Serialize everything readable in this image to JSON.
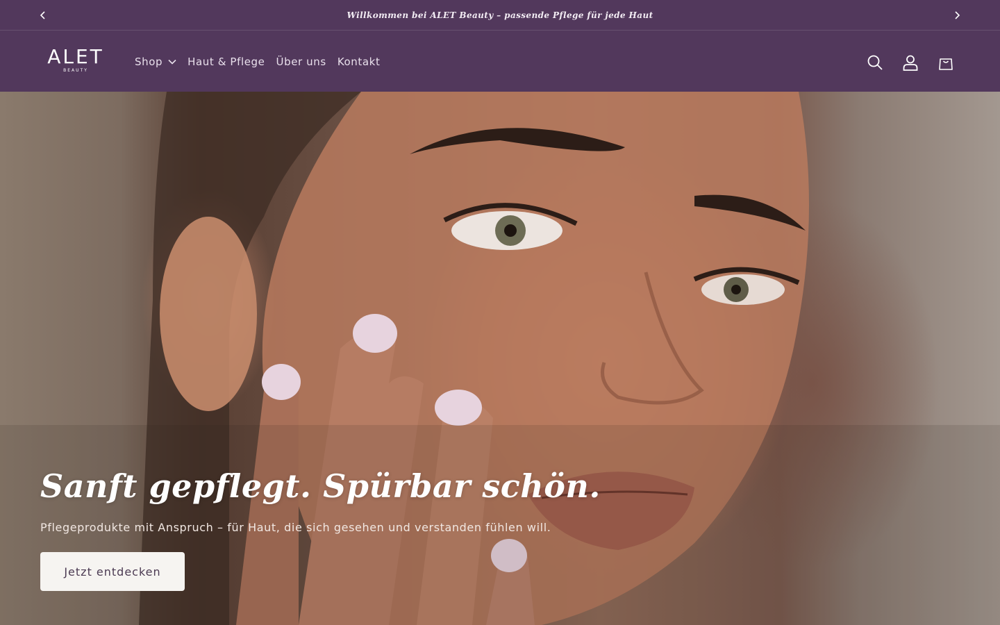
{
  "announcement": {
    "message": "Willkommen bei ALET Beauty – passende Pflege für jede Haut",
    "prev_icon": "chevron-left-icon",
    "next_icon": "chevron-right-icon"
  },
  "header": {
    "logo": {
      "wordmark": "ALET",
      "sub": "BEAUTY"
    },
    "nav": [
      {
        "label": "Shop",
        "has_dropdown": true
      },
      {
        "label": "Haut & Pflege"
      },
      {
        "label": "Über uns"
      },
      {
        "label": "Kontakt"
      }
    ],
    "icons": [
      "search-icon",
      "account-icon",
      "cart-icon"
    ]
  },
  "hero": {
    "title": "Sanft gepflegt. Spürbar schön.",
    "subtitle": "Pflegeprodukte mit Anspruch – für Haut, die sich gesehen und verstanden fühlen will.",
    "cta_label": "Jetzt entdecken"
  },
  "colors": {
    "header_bg": "#52385c",
    "text_light": "#ffffff",
    "button_bg": "#f6f4f1",
    "button_text": "#4b3a52"
  }
}
